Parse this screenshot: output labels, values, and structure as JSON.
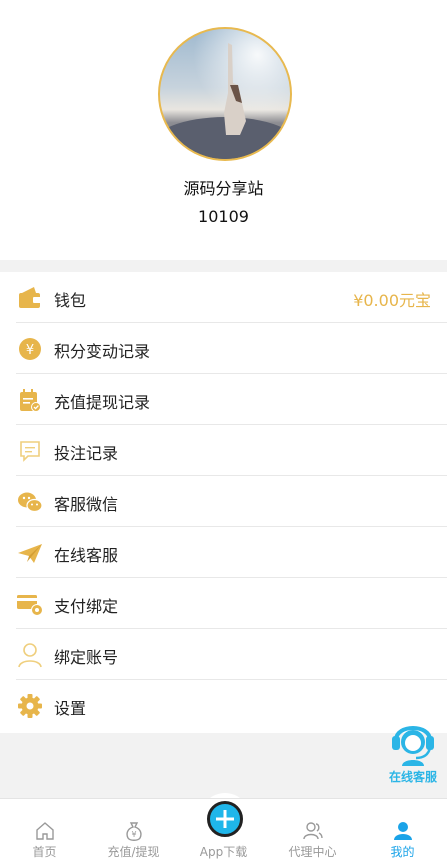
{
  "profile": {
    "nickname": "源码分享站",
    "uid": "10109"
  },
  "menu": {
    "wallet": {
      "label": "钱包",
      "value": "¥0.00元宝",
      "icon": "wallet-icon"
    },
    "points": {
      "label": "积分变动记录",
      "icon": "yen-coin-icon"
    },
    "recharge": {
      "label": "充值提现记录",
      "icon": "calendar-check-icon"
    },
    "bets": {
      "label": "投注记录",
      "icon": "message-icon"
    },
    "wechat": {
      "label": "客服微信",
      "icon": "wechat-icon"
    },
    "online": {
      "label": "在线客服",
      "icon": "paper-plane-icon"
    },
    "payment": {
      "label": "支付绑定",
      "icon": "card-gear-icon"
    },
    "account": {
      "label": "绑定账号",
      "icon": "user-icon"
    },
    "settings": {
      "label": "设置",
      "icon": "gear-icon"
    }
  },
  "floating_service": {
    "label": "在线客服",
    "icon": "headset-icon"
  },
  "tabbar": {
    "home": "首页",
    "recharge": "充值/提现",
    "app": "App下载",
    "agent": "代理中心",
    "mine": "我的"
  },
  "colors": {
    "accent_gold": "#e7b54b",
    "accent_blue": "#1aa3e8",
    "text": "#222222",
    "background": "#f2f2f2"
  }
}
